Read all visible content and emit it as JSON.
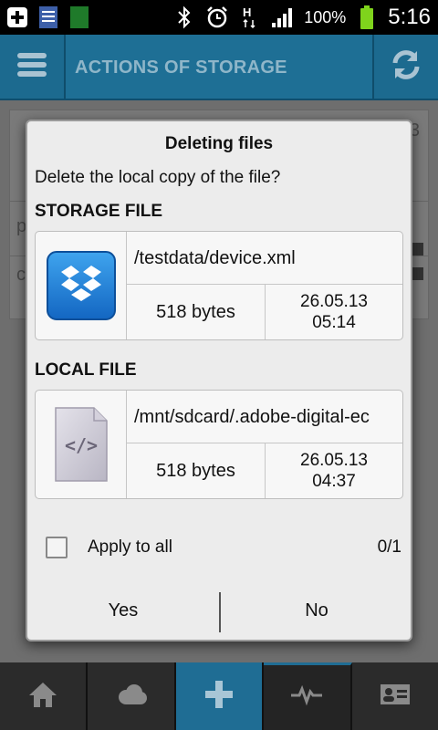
{
  "status_bar": {
    "battery_text": "100%",
    "time": "5:16",
    "icons": [
      "add-icon",
      "notes-icon",
      "app-icon",
      "bluetooth-icon",
      "alarm-icon",
      "hspa-icon",
      "signal-icon",
      "battery-icon"
    ]
  },
  "app_bar": {
    "title": "ACTIONS OF STORAGE",
    "menu_icon": "menu-icon",
    "refresh_icon": "refresh-icon"
  },
  "background_peek": {
    "top_right": "3",
    "row_left_1": "p",
    "row_left_2": "c"
  },
  "dialog": {
    "title": "Deleting files",
    "question": "Delete the local copy of the file?",
    "storage_section": {
      "label": "STORAGE FILE",
      "icon": "dropbox-icon",
      "path": "/testdata/device.xml",
      "size": "518 bytes",
      "date": "26.05.13",
      "time": "05:14"
    },
    "local_section": {
      "label": "LOCAL FILE",
      "icon": "xml-file-icon",
      "path": "/mnt/sdcard/.adobe-digital-ec",
      "size": "518 bytes",
      "date": "26.05.13",
      "time": "04:37"
    },
    "apply_all": {
      "label": "Apply to all",
      "checked": false
    },
    "counter": "0/1",
    "buttons": {
      "yes": "Yes",
      "no": "No"
    }
  },
  "bottom_nav": {
    "items": [
      "home-icon",
      "cloud-icon",
      "add-icon",
      "activity-icon",
      "contact-card-icon"
    ],
    "active": "add-icon",
    "selected": "activity-icon"
  },
  "colors": {
    "accent": "#1e6f95",
    "dialog_bg": "#ececec",
    "dropbox_blue": "#1a80d6"
  }
}
